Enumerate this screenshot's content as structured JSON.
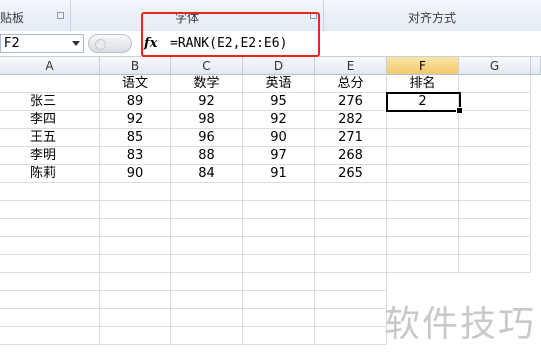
{
  "ribbon": {
    "groups": [
      "贴板",
      "字体",
      "对齐方式"
    ]
  },
  "formula_bar": {
    "name_box": "F2",
    "fx_label": "fx",
    "formula": "=RANK(E2,E2:E6)"
  },
  "columns": [
    "A",
    "B",
    "C",
    "D",
    "E",
    "F",
    "G"
  ],
  "headers": [
    "",
    "语文",
    "数学",
    "英语",
    "总分",
    "排名",
    ""
  ],
  "rows": [
    [
      "张三",
      "89",
      "92",
      "95",
      "276",
      "2"
    ],
    [
      "李四",
      "92",
      "98",
      "92",
      "282",
      ""
    ],
    [
      "王五",
      "85",
      "96",
      "90",
      "271",
      ""
    ],
    [
      "李明",
      "83",
      "88",
      "97",
      "268",
      ""
    ],
    [
      "陈莉",
      "90",
      "84",
      "91",
      "265",
      ""
    ]
  ],
  "active_cell": "F2",
  "watermark": "软件技巧",
  "colors": {
    "highlight_box": "#e8271d",
    "active_header": "#f3c96b"
  }
}
